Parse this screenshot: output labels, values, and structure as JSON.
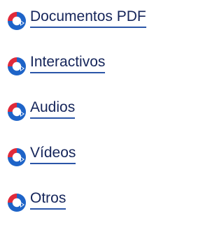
{
  "menu": {
    "items": [
      {
        "label": "Documentos PDF",
        "icon": "play-circle-icon"
      },
      {
        "label": "Interactivos",
        "icon": "play-circle-icon"
      },
      {
        "label": "Audios",
        "icon": "play-circle-icon"
      },
      {
        "label": "Vídeos",
        "icon": "play-circle-icon"
      },
      {
        "label": "Otros",
        "icon": "play-circle-icon"
      }
    ]
  },
  "colors": {
    "icon_red": "#e02a3a",
    "icon_blue": "#1e64c8",
    "link_text": "#15255a",
    "link_underline": "#2b56a8"
  }
}
